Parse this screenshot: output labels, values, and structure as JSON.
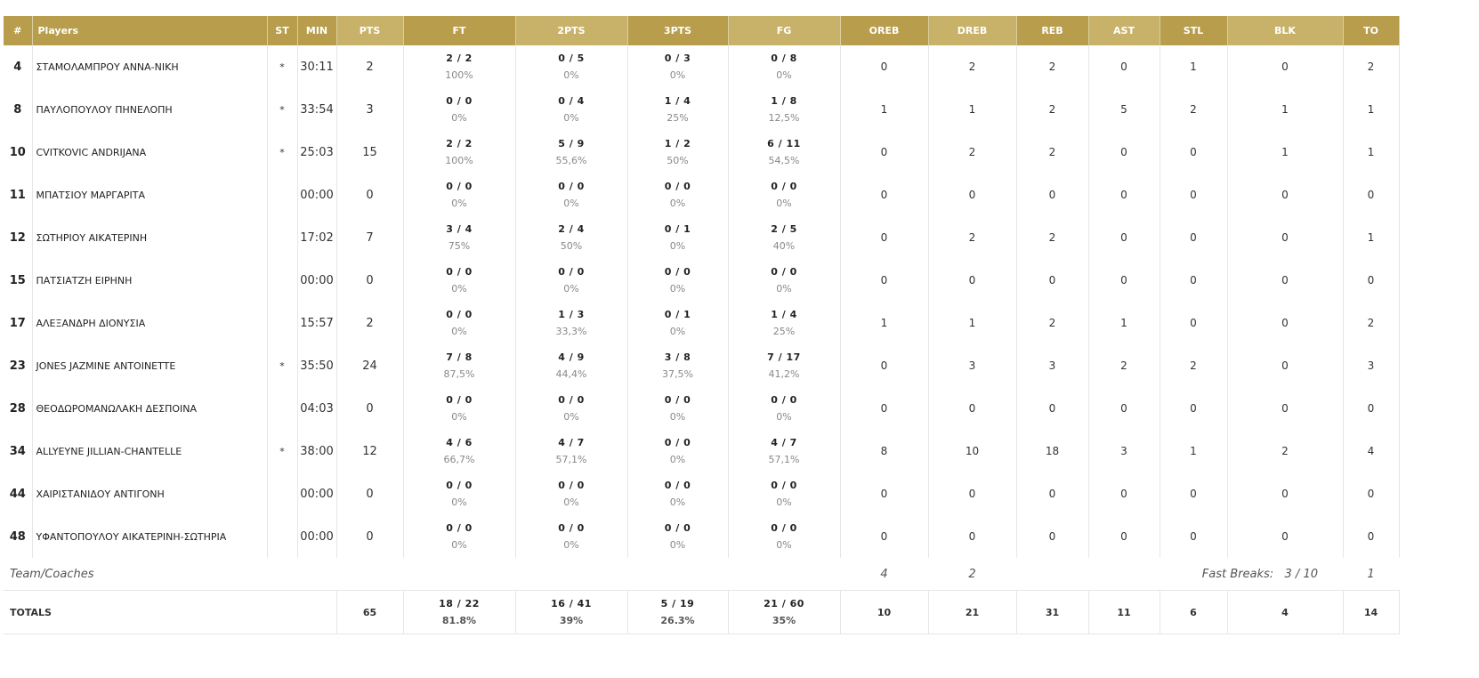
{
  "headers": {
    "num": "#",
    "players": "Players",
    "st": "ST",
    "min": "MIN",
    "pts": "PTS",
    "ft": "FT",
    "two": "2PTS",
    "three": "3PTS",
    "fg": "FG",
    "oreb": "OREB",
    "dreb": "DREB",
    "reb": "REB",
    "ast": "AST",
    "stl": "STL",
    "blk": "BLK",
    "to": "TO"
  },
  "players": [
    {
      "num": "4",
      "name": "ΣΤΑΜΟΛΑΜΠΡΟΥ ΑΝΝΑ-ΝΙΚΗ",
      "st": "*",
      "min": "30:11",
      "pts": "2",
      "ft": "2 / 2",
      "ft_pct": "100%",
      "two": "0 / 5",
      "two_pct": "0%",
      "three": "0 / 3",
      "three_pct": "0%",
      "fg": "0 / 8",
      "fg_pct": "0%",
      "oreb": "0",
      "dreb": "2",
      "reb": "2",
      "ast": "0",
      "stl": "1",
      "blk": "0",
      "to": "2"
    },
    {
      "num": "8",
      "name": "ΠΑΥΛΟΠΟΥΛΟΥ ΠΗΝΕΛΟΠΗ",
      "st": "*",
      "min": "33:54",
      "pts": "3",
      "ft": "0 / 0",
      "ft_pct": "0%",
      "two": "0 / 4",
      "two_pct": "0%",
      "three": "1 / 4",
      "three_pct": "25%",
      "fg": "1 / 8",
      "fg_pct": "12,5%",
      "oreb": "1",
      "dreb": "1",
      "reb": "2",
      "ast": "5",
      "stl": "2",
      "blk": "1",
      "to": "1"
    },
    {
      "num": "10",
      "name": "CVITKOVIC ANDRIJANA",
      "st": "*",
      "min": "25:03",
      "pts": "15",
      "ft": "2 / 2",
      "ft_pct": "100%",
      "two": "5 / 9",
      "two_pct": "55,6%",
      "three": "1 / 2",
      "three_pct": "50%",
      "fg": "6 / 11",
      "fg_pct": "54,5%",
      "oreb": "0",
      "dreb": "2",
      "reb": "2",
      "ast": "0",
      "stl": "0",
      "blk": "1",
      "to": "1"
    },
    {
      "num": "11",
      "name": "ΜΠΑΤΣΙΟΥ ΜΑΡΓΑΡΙΤΑ",
      "st": "",
      "min": "00:00",
      "pts": "0",
      "ft": "0 / 0",
      "ft_pct": "0%",
      "two": "0 / 0",
      "two_pct": "0%",
      "three": "0 / 0",
      "three_pct": "0%",
      "fg": "0 / 0",
      "fg_pct": "0%",
      "oreb": "0",
      "dreb": "0",
      "reb": "0",
      "ast": "0",
      "stl": "0",
      "blk": "0",
      "to": "0"
    },
    {
      "num": "12",
      "name": "ΣΩΤΗΡΙΟΥ ΑΙΚΑΤΕΡΙΝΗ",
      "st": "",
      "min": "17:02",
      "pts": "7",
      "ft": "3 / 4",
      "ft_pct": "75%",
      "two": "2 / 4",
      "two_pct": "50%",
      "three": "0 / 1",
      "three_pct": "0%",
      "fg": "2 / 5",
      "fg_pct": "40%",
      "oreb": "0",
      "dreb": "2",
      "reb": "2",
      "ast": "0",
      "stl": "0",
      "blk": "0",
      "to": "1"
    },
    {
      "num": "15",
      "name": "ΠΑΤΣΙΑΤΖΗ ΕΙΡΗΝΗ",
      "st": "",
      "min": "00:00",
      "pts": "0",
      "ft": "0 / 0",
      "ft_pct": "0%",
      "two": "0 / 0",
      "two_pct": "0%",
      "three": "0 / 0",
      "three_pct": "0%",
      "fg": "0 / 0",
      "fg_pct": "0%",
      "oreb": "0",
      "dreb": "0",
      "reb": "0",
      "ast": "0",
      "stl": "0",
      "blk": "0",
      "to": "0"
    },
    {
      "num": "17",
      "name": "ΑΛΕΞΑΝΔΡΗ ΔΙΟΝΥΣΙΑ",
      "st": "",
      "min": "15:57",
      "pts": "2",
      "ft": "0 / 0",
      "ft_pct": "0%",
      "two": "1 / 3",
      "two_pct": "33,3%",
      "three": "0 / 1",
      "three_pct": "0%",
      "fg": "1 / 4",
      "fg_pct": "25%",
      "oreb": "1",
      "dreb": "1",
      "reb": "2",
      "ast": "1",
      "stl": "0",
      "blk": "0",
      "to": "2"
    },
    {
      "num": "23",
      "name": "JONES JAZMINE ANTOINETTE",
      "st": "*",
      "min": "35:50",
      "pts": "24",
      "ft": "7 / 8",
      "ft_pct": "87,5%",
      "two": "4 / 9",
      "two_pct": "44,4%",
      "three": "3 / 8",
      "three_pct": "37,5%",
      "fg": "7 / 17",
      "fg_pct": "41,2%",
      "oreb": "0",
      "dreb": "3",
      "reb": "3",
      "ast": "2",
      "stl": "2",
      "blk": "0",
      "to": "3"
    },
    {
      "num": "28",
      "name": "ΘΕΟΔΩΡΟΜΑΝΩΛΑΚΗ ΔΕΣΠΟΙΝΑ",
      "st": "",
      "min": "04:03",
      "pts": "0",
      "ft": "0 / 0",
      "ft_pct": "0%",
      "two": "0 / 0",
      "two_pct": "0%",
      "three": "0 / 0",
      "three_pct": "0%",
      "fg": "0 / 0",
      "fg_pct": "0%",
      "oreb": "0",
      "dreb": "0",
      "reb": "0",
      "ast": "0",
      "stl": "0",
      "blk": "0",
      "to": "0"
    },
    {
      "num": "34",
      "name": "ALLYEYNE JILLIAN-CHANTELLE",
      "st": "*",
      "min": "38:00",
      "pts": "12",
      "ft": "4 / 6",
      "ft_pct": "66,7%",
      "two": "4 / 7",
      "two_pct": "57,1%",
      "three": "0 / 0",
      "three_pct": "0%",
      "fg": "4 / 7",
      "fg_pct": "57,1%",
      "oreb": "8",
      "dreb": "10",
      "reb": "18",
      "ast": "3",
      "stl": "1",
      "blk": "2",
      "to": "4"
    },
    {
      "num": "44",
      "name": "ΧΑΙΡΙΣΤΑΝΙΔΟΥ ΑΝΤΙΓΟΝΗ",
      "st": "",
      "min": "00:00",
      "pts": "0",
      "ft": "0 / 0",
      "ft_pct": "0%",
      "two": "0 / 0",
      "two_pct": "0%",
      "three": "0 / 0",
      "three_pct": "0%",
      "fg": "0 / 0",
      "fg_pct": "0%",
      "oreb": "0",
      "dreb": "0",
      "reb": "0",
      "ast": "0",
      "stl": "0",
      "blk": "0",
      "to": "0"
    },
    {
      "num": "48",
      "name": "ΥΦΑΝΤΟΠΟΥΛΟΥ ΑΙΚΑΤΕΡΙΝΗ-ΣΩΤΗΡΙΑ",
      "st": "",
      "min": "00:00",
      "pts": "0",
      "ft": "0 / 0",
      "ft_pct": "0%",
      "two": "0 / 0",
      "two_pct": "0%",
      "three": "0 / 0",
      "three_pct": "0%",
      "fg": "0 / 0",
      "fg_pct": "0%",
      "oreb": "0",
      "dreb": "0",
      "reb": "0",
      "ast": "0",
      "stl": "0",
      "blk": "0",
      "to": "0"
    }
  ],
  "team": {
    "label": "Team/Coaches",
    "oreb": "4",
    "dreb": "2",
    "fast_breaks_label": "Fast Breaks:",
    "fast_breaks_value": "3 / 10",
    "to": "1"
  },
  "totals": {
    "label": "TOTALS",
    "pts": "65",
    "ft": "18 / 22",
    "ft_pct": "81.8%",
    "two": "16 / 41",
    "two_pct": "39%",
    "three": "5 / 19",
    "three_pct": "26.3%",
    "fg": "21 / 60",
    "fg_pct": "35%",
    "oreb": "10",
    "dreb": "21",
    "reb": "31",
    "ast": "11",
    "stl": "6",
    "blk": "4",
    "to": "14"
  },
  "colors": {
    "header_dark": "#b79d4c",
    "header_light": "#c8b26a"
  }
}
